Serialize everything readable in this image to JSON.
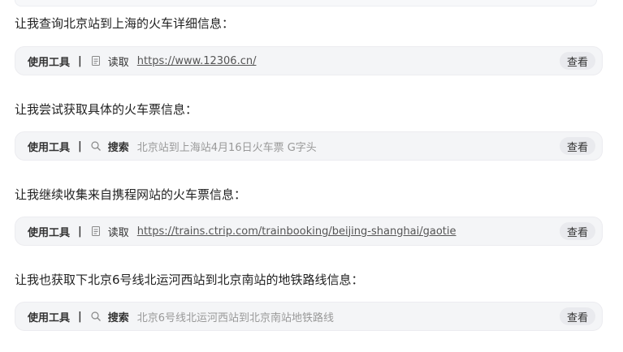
{
  "steps": [
    {
      "text": "让我查询北京站到上海的火车详细信息：",
      "tool_label": "使用工具",
      "separator": "|",
      "icon": "document-icon",
      "action": "读取",
      "target": "https://www.12306.cn/",
      "button": "查看"
    },
    {
      "text": "让我尝试获取具体的火车票信息：",
      "tool_label": "使用工具",
      "separator": "|",
      "icon": "search-icon",
      "action": "搜索",
      "target": "北京站到上海站4月16日火车票 G字头",
      "button": "查看"
    },
    {
      "text": "让我继续收集来自携程网站的火车票信息：",
      "tool_label": "使用工具",
      "separator": "|",
      "icon": "document-icon",
      "action": "读取",
      "target": "https://trains.ctrip.com/trainbooking/beijing-shanghai/gaotie",
      "button": "查看"
    },
    {
      "text": "让我也获取下北京6号线北运河西站到北京南站的地铁路线信息：",
      "tool_label": "使用工具",
      "separator": "|",
      "icon": "search-icon",
      "action": "搜索",
      "target": "北京6号线北运河西站到北京南站地铁路线",
      "button": "查看"
    }
  ]
}
